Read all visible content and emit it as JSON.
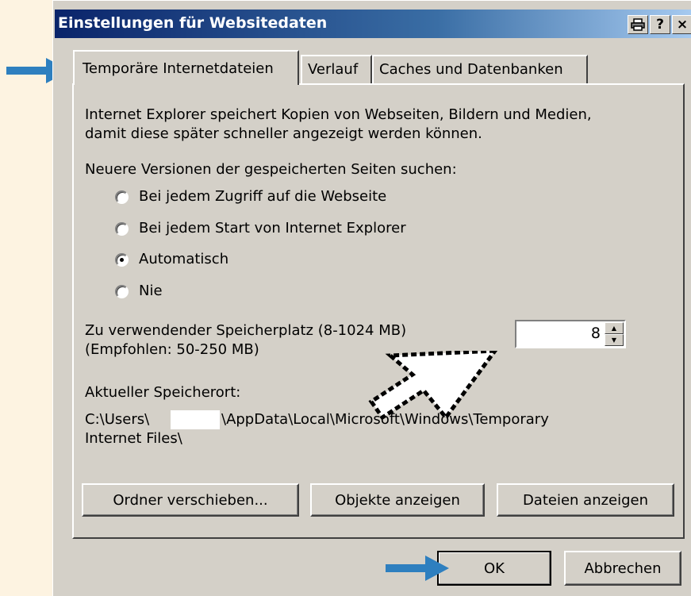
{
  "window": {
    "title": "Einstellungen für Websitedaten",
    "titlebar_buttons": {
      "help": "?",
      "close": "×"
    }
  },
  "tabs": [
    {
      "label": "Temporäre Internetdateien",
      "active": true
    },
    {
      "label": "Verlauf",
      "active": false
    },
    {
      "label": "Caches und Datenbanken",
      "active": false
    }
  ],
  "panel": {
    "intro_line1": "Internet Explorer speichert Kopien von Webseiten, Bildern und Medien,",
    "intro_line2": "damit diese später schneller angezeigt werden können.",
    "check_label": "Neuere Versionen der gespeicherten Seiten suchen:",
    "radio_options": [
      {
        "label": "Bei jedem Zugriff auf die Webseite",
        "selected": false
      },
      {
        "label": "Bei jedem Start von Internet Explorer",
        "selected": false
      },
      {
        "label": "Automatisch",
        "selected": true
      },
      {
        "label": "Nie",
        "selected": false
      }
    ],
    "space_label_line1": "Zu verwendender Speicherplatz (8-1024 MB)",
    "space_label_line2": "(Empfohlen: 50-250 MB)",
    "space_value": "8",
    "location_label": "Aktueller Speicherort:",
    "location_path_part1": "C:\\Users\\",
    "location_path_part2": "\\AppData\\Local\\Microsoft\\Windows\\Temporary",
    "location_path_line2": "Internet Files\\",
    "buttons": {
      "move_folder": "Ordner verschieben...",
      "view_objects": "Objekte anzeigen",
      "view_files": "Dateien anzeigen"
    }
  },
  "footer": {
    "ok": "OK",
    "cancel": "Abbrechen"
  },
  "colors": {
    "annotation_arrow": "#2e7fbf",
    "titlebar_start": "#0a246a",
    "dialog_bg": "#d4d0c8",
    "page_bg": "#fdf3e1"
  }
}
